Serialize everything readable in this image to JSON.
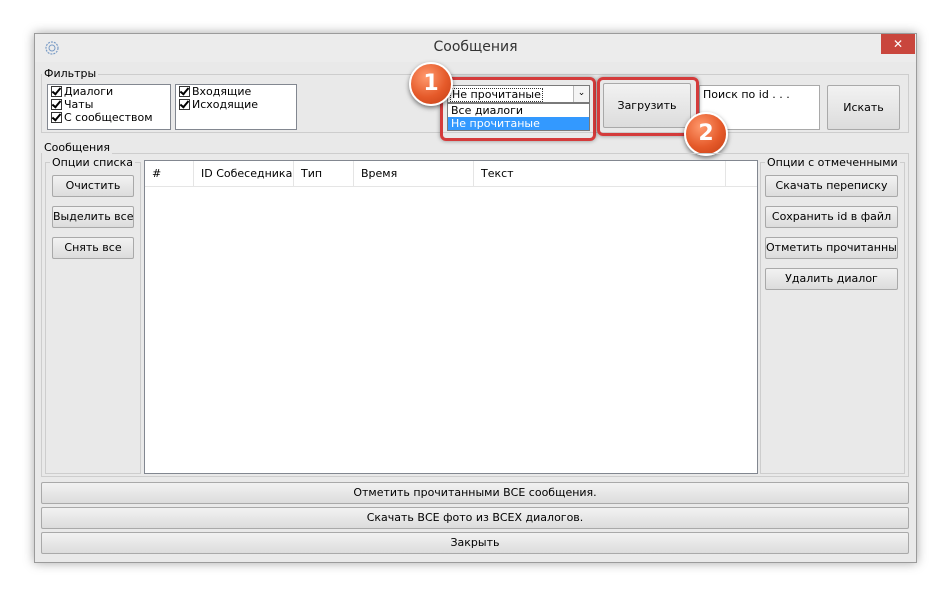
{
  "window": {
    "title": "Сообщения",
    "close_glyph": "✕"
  },
  "filters": {
    "label": "Фильтры",
    "types": [
      {
        "label": "Диалоги",
        "checked": true
      },
      {
        "label": "Чаты",
        "checked": true
      },
      {
        "label": "С сообществом",
        "checked": true
      }
    ],
    "directions": [
      {
        "label": "Входящие",
        "checked": true
      },
      {
        "label": "Исходящие",
        "checked": true
      }
    ],
    "mode_select": {
      "value": "Не прочитаные",
      "options": [
        "Все диалоги",
        "Не прочитаные"
      ],
      "arrow_glyph": "⌄"
    },
    "load_button": "Загрузить",
    "search_placeholder": "Поиск по id . . .",
    "search_button": "Искать"
  },
  "annotations": {
    "badge_1": "1",
    "badge_2": "2"
  },
  "messages": {
    "label": "Сообщения",
    "list_options": {
      "label": "Опции списка",
      "clear": "Очистить",
      "select_all": "Выделить все",
      "deselect_all": "Снять все"
    },
    "columns": [
      "#",
      "ID Собеседника",
      "Тип",
      "Время",
      "Текст"
    ],
    "selected_options": {
      "label": "Опции с отмеченными",
      "download": "Скачать переписку",
      "save_ids": "Сохранить id в файл",
      "mark_read": "Отметить прочитанными",
      "delete": "Удалить диалог"
    }
  },
  "footer": {
    "mark_all": "Отметить прочитанными ВСЕ сообщения.",
    "download_photos": "Скачать ВСЕ фото из ВСЕХ диалогов.",
    "close": "Закрыть"
  },
  "colors": {
    "accent_red": "#d43b3b",
    "badge_orange": "#e55a2a",
    "selection_blue": "#3399ff"
  }
}
